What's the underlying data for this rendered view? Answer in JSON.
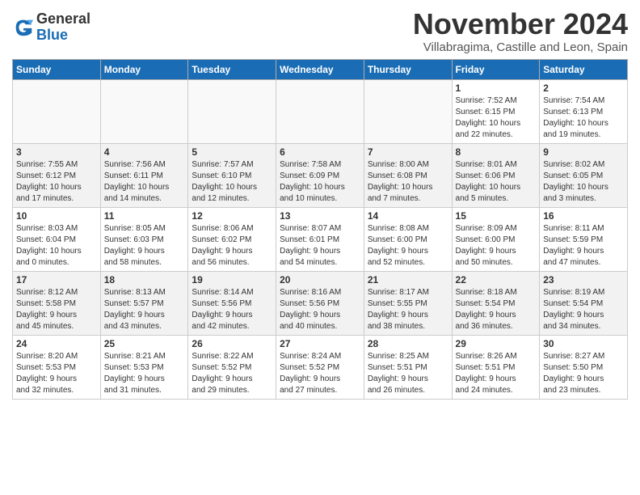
{
  "logo": {
    "general": "General",
    "blue": "Blue"
  },
  "title": "November 2024",
  "subtitle": "Villabragima, Castille and Leon, Spain",
  "headers": [
    "Sunday",
    "Monday",
    "Tuesday",
    "Wednesday",
    "Thursday",
    "Friday",
    "Saturday"
  ],
  "weeks": [
    [
      {
        "day": "",
        "info": ""
      },
      {
        "day": "",
        "info": ""
      },
      {
        "day": "",
        "info": ""
      },
      {
        "day": "",
        "info": ""
      },
      {
        "day": "",
        "info": ""
      },
      {
        "day": "1",
        "info": "Sunrise: 7:52 AM\nSunset: 6:15 PM\nDaylight: 10 hours\nand 22 minutes."
      },
      {
        "day": "2",
        "info": "Sunrise: 7:54 AM\nSunset: 6:13 PM\nDaylight: 10 hours\nand 19 minutes."
      }
    ],
    [
      {
        "day": "3",
        "info": "Sunrise: 7:55 AM\nSunset: 6:12 PM\nDaylight: 10 hours\nand 17 minutes."
      },
      {
        "day": "4",
        "info": "Sunrise: 7:56 AM\nSunset: 6:11 PM\nDaylight: 10 hours\nand 14 minutes."
      },
      {
        "day": "5",
        "info": "Sunrise: 7:57 AM\nSunset: 6:10 PM\nDaylight: 10 hours\nand 12 minutes."
      },
      {
        "day": "6",
        "info": "Sunrise: 7:58 AM\nSunset: 6:09 PM\nDaylight: 10 hours\nand 10 minutes."
      },
      {
        "day": "7",
        "info": "Sunrise: 8:00 AM\nSunset: 6:08 PM\nDaylight: 10 hours\nand 7 minutes."
      },
      {
        "day": "8",
        "info": "Sunrise: 8:01 AM\nSunset: 6:06 PM\nDaylight: 10 hours\nand 5 minutes."
      },
      {
        "day": "9",
        "info": "Sunrise: 8:02 AM\nSunset: 6:05 PM\nDaylight: 10 hours\nand 3 minutes."
      }
    ],
    [
      {
        "day": "10",
        "info": "Sunrise: 8:03 AM\nSunset: 6:04 PM\nDaylight: 10 hours\nand 0 minutes."
      },
      {
        "day": "11",
        "info": "Sunrise: 8:05 AM\nSunset: 6:03 PM\nDaylight: 9 hours\nand 58 minutes."
      },
      {
        "day": "12",
        "info": "Sunrise: 8:06 AM\nSunset: 6:02 PM\nDaylight: 9 hours\nand 56 minutes."
      },
      {
        "day": "13",
        "info": "Sunrise: 8:07 AM\nSunset: 6:01 PM\nDaylight: 9 hours\nand 54 minutes."
      },
      {
        "day": "14",
        "info": "Sunrise: 8:08 AM\nSunset: 6:00 PM\nDaylight: 9 hours\nand 52 minutes."
      },
      {
        "day": "15",
        "info": "Sunrise: 8:09 AM\nSunset: 6:00 PM\nDaylight: 9 hours\nand 50 minutes."
      },
      {
        "day": "16",
        "info": "Sunrise: 8:11 AM\nSunset: 5:59 PM\nDaylight: 9 hours\nand 47 minutes."
      }
    ],
    [
      {
        "day": "17",
        "info": "Sunrise: 8:12 AM\nSunset: 5:58 PM\nDaylight: 9 hours\nand 45 minutes."
      },
      {
        "day": "18",
        "info": "Sunrise: 8:13 AM\nSunset: 5:57 PM\nDaylight: 9 hours\nand 43 minutes."
      },
      {
        "day": "19",
        "info": "Sunrise: 8:14 AM\nSunset: 5:56 PM\nDaylight: 9 hours\nand 42 minutes."
      },
      {
        "day": "20",
        "info": "Sunrise: 8:16 AM\nSunset: 5:56 PM\nDaylight: 9 hours\nand 40 minutes."
      },
      {
        "day": "21",
        "info": "Sunrise: 8:17 AM\nSunset: 5:55 PM\nDaylight: 9 hours\nand 38 minutes."
      },
      {
        "day": "22",
        "info": "Sunrise: 8:18 AM\nSunset: 5:54 PM\nDaylight: 9 hours\nand 36 minutes."
      },
      {
        "day": "23",
        "info": "Sunrise: 8:19 AM\nSunset: 5:54 PM\nDaylight: 9 hours\nand 34 minutes."
      }
    ],
    [
      {
        "day": "24",
        "info": "Sunrise: 8:20 AM\nSunset: 5:53 PM\nDaylight: 9 hours\nand 32 minutes."
      },
      {
        "day": "25",
        "info": "Sunrise: 8:21 AM\nSunset: 5:53 PM\nDaylight: 9 hours\nand 31 minutes."
      },
      {
        "day": "26",
        "info": "Sunrise: 8:22 AM\nSunset: 5:52 PM\nDaylight: 9 hours\nand 29 minutes."
      },
      {
        "day": "27",
        "info": "Sunrise: 8:24 AM\nSunset: 5:52 PM\nDaylight: 9 hours\nand 27 minutes."
      },
      {
        "day": "28",
        "info": "Sunrise: 8:25 AM\nSunset: 5:51 PM\nDaylight: 9 hours\nand 26 minutes."
      },
      {
        "day": "29",
        "info": "Sunrise: 8:26 AM\nSunset: 5:51 PM\nDaylight: 9 hours\nand 24 minutes."
      },
      {
        "day": "30",
        "info": "Sunrise: 8:27 AM\nSunset: 5:50 PM\nDaylight: 9 hours\nand 23 minutes."
      }
    ]
  ]
}
